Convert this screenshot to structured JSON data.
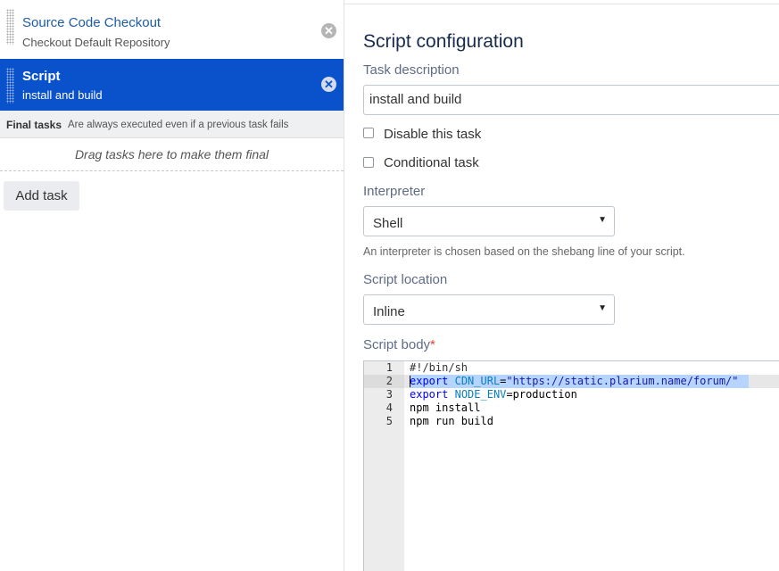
{
  "tasks": [
    {
      "title": "Source Code Checkout",
      "subtitle": "Checkout Default Repository",
      "delete_glyph": "✕"
    },
    {
      "title": "Script",
      "subtitle": "install and build",
      "delete_glyph": "✕"
    }
  ],
  "final_tasks": {
    "label": "Final tasks",
    "description": "Are always executed even if a previous task fails",
    "drop_hint": "Drag tasks here to make them final"
  },
  "add_task_label": "Add task",
  "config": {
    "heading": "Script configuration",
    "task_description_label": "Task description",
    "task_description_value": "install and build",
    "disable_label": "Disable this task",
    "conditional_label": "Conditional task",
    "interpreter_label": "Interpreter",
    "interpreter_value": "Shell",
    "interpreter_help": "An interpreter is chosen based on the shebang line of your script.",
    "location_label": "Script location",
    "location_value": "Inline",
    "body_label": "Script body",
    "required_mark": "*"
  },
  "editor": {
    "line_numbers": [
      "1",
      "2",
      "3",
      "4",
      "5"
    ],
    "line1": "#!/bin/sh",
    "line2_kw": "export",
    "line2_var": "CDN_URL",
    "line2_eq": "=",
    "line2_str": "\"https://static.plarium.name/forum/\"",
    "line3_kw": "export",
    "line3_var": "NODE_ENV",
    "line3_rest": "=production",
    "line4": "npm install",
    "line5": "npm run build"
  },
  "icons": {
    "select_arrow": "▼"
  },
  "colors": {
    "selected_task_bg": "#0a52cc",
    "link": "#1d5ca8",
    "required": "#d04437"
  }
}
